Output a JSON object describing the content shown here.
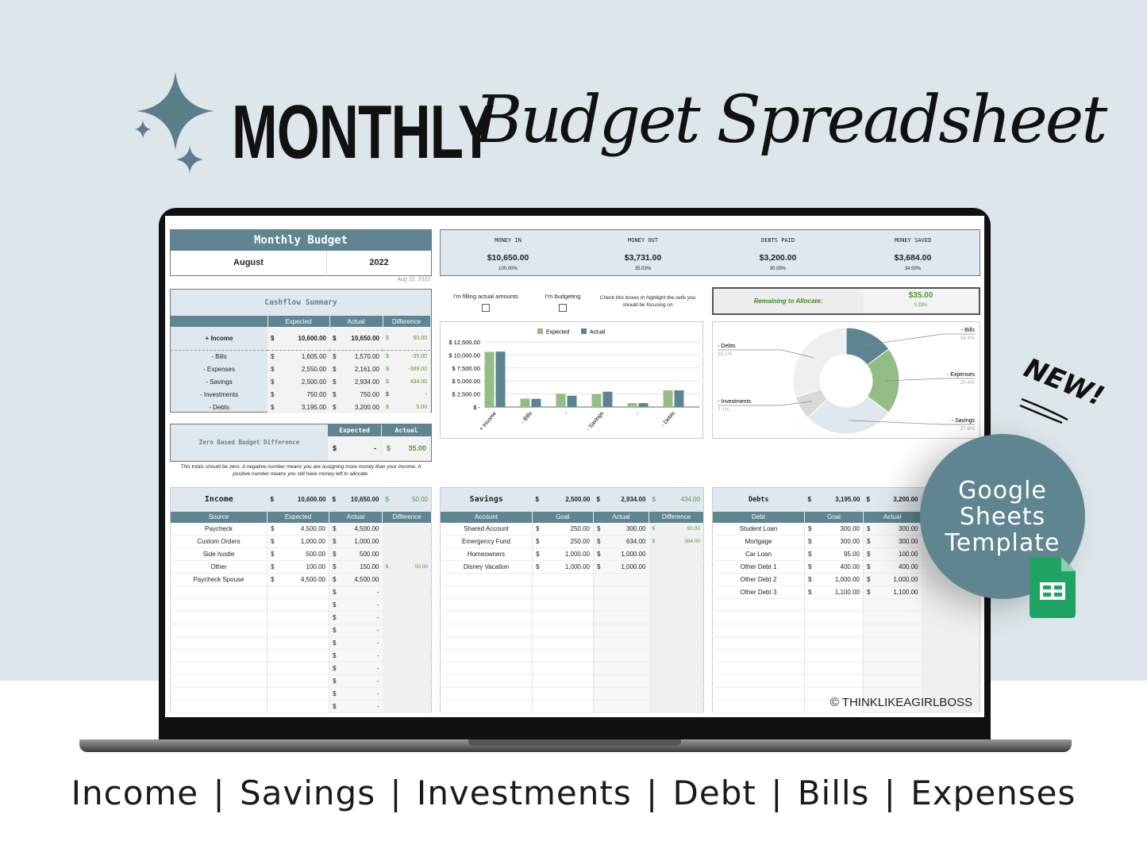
{
  "headline": {
    "bold": "MONTHLY",
    "script": "Budget Spreadsheet"
  },
  "footer_categories": "Income  |  Savings  |  Investments  |  Debt  |  Bills  |  Expenses",
  "badge": {
    "text_lines": [
      "Google",
      "Sheets",
      "Template"
    ],
    "new_label": "NEW!",
    "copyright": "© THINKLIKEAGIRLBOSS"
  },
  "colors": {
    "header": "#5f8591",
    "light": "#dfe8ee",
    "positive": "#4f9a2c",
    "expected_bar": "#93bd86",
    "actual_bar": "#5d8491",
    "sheets_green": "#1fa463"
  },
  "sheet": {
    "title": "Monthly Budget",
    "month": "August",
    "year": "2022",
    "date": "Aug 31, 2022",
    "kpis": [
      {
        "label": "MONEY IN",
        "value": "$10,650.00",
        "pct": "100.00%"
      },
      {
        "label": "MONEY OUT",
        "value": "$3,731.00",
        "pct": "35.03%"
      },
      {
        "label": "DEBTS PAID",
        "value": "$3,200.00",
        "pct": "30.05%"
      },
      {
        "label": "MONEY SAVED",
        "value": "$3,684.00",
        "pct": "34.59%"
      }
    ],
    "checkboxes": {
      "actual_label": "I'm filling actual amounts",
      "budget_label": "I'm budgeting",
      "actual_checked": false,
      "budget_checked": false,
      "hint": "Check this boxes to highlight the cells you should be focusing on"
    },
    "remaining": {
      "label": "Remaining to Allocate:",
      "value": "$35.00",
      "pct": "0.33%"
    },
    "cashflow": {
      "title": "Cashflow Summary",
      "columns": [
        "",
        "Expected",
        "Actual",
        "Difference"
      ],
      "rows": [
        {
          "name": "+ Income",
          "expected": "10,600.00",
          "actual": "10,650.00",
          "diff": "50.00"
        },
        {
          "name": "- Bills",
          "expected": "1,605.00",
          "actual": "1,570.00",
          "diff": "-35.00"
        },
        {
          "name": "- Expenses",
          "expected": "2,550.00",
          "actual": "2,161.00",
          "diff": "-389.00"
        },
        {
          "name": "- Savings",
          "expected": "2,500.00",
          "actual": "2,934.00",
          "diff": "434.00"
        },
        {
          "name": "- Investments",
          "expected": "750.00",
          "actual": "750.00",
          "diff": "-"
        },
        {
          "name": "- Debts",
          "expected": "3,195.00",
          "actual": "3,200.00",
          "diff": "5.00"
        }
      ]
    },
    "zero_based": {
      "title": "Zero Based Budget Difference",
      "expected_label": "Expected",
      "actual_label": "Actual",
      "expected": "-",
      "actual": "35.00",
      "note": "This totals should be zero. A negative number means you are assigning more money than your income. A positive number means you still have money left to allocate."
    },
    "income": {
      "title": "Income",
      "expected_total": "10,600.00",
      "actual_total": "10,650.00",
      "diff_total": "50.00",
      "columns": [
        "Source",
        "Expected",
        "Actual",
        "Difference"
      ],
      "rows": [
        {
          "name": "Paycheck",
          "expected": "4,500.00",
          "actual": "4,500.00"
        },
        {
          "name": "Custom Orders",
          "expected": "1,000.00",
          "actual": "1,000.00"
        },
        {
          "name": "Side hustle",
          "expected": "500.00",
          "actual": "500.00"
        },
        {
          "name": "Other",
          "expected": "100.00",
          "actual": "150.00",
          "diff": "50.00"
        },
        {
          "name": "Paycheck Spouse",
          "expected": "4,500.00",
          "actual": "4,500.00"
        },
        {
          "actual": "-"
        },
        {
          "actual": "-"
        },
        {
          "actual": "-"
        },
        {
          "actual": "-"
        },
        {
          "actual": "-"
        },
        {
          "actual": "-"
        },
        {
          "actual": "-"
        },
        {
          "actual": "-"
        },
        {
          "actual": "-"
        },
        {
          "actual": "-"
        }
      ]
    },
    "savings": {
      "title": "Savings",
      "expected_total": "2,500.00",
      "actual_total": "2,934.00",
      "diff_total": "434.00",
      "columns": [
        "Account",
        "Goal",
        "Actual",
        "Difference"
      ],
      "rows": [
        {
          "name": "Shared Account",
          "expected": "250.00",
          "actual": "300.00",
          "diff": "50.00"
        },
        {
          "name": "Emergency Fund",
          "expected": "250.00",
          "actual": "634.00",
          "diff": "384.00"
        },
        {
          "name": "Homeowners",
          "expected": "1,000.00",
          "actual": "1,000.00"
        },
        {
          "name": "Disney Vacation",
          "expected": "1,000.00",
          "actual": "1,000.00"
        },
        {},
        {},
        {},
        {},
        {},
        {},
        {},
        {},
        {},
        {},
        {}
      ]
    },
    "debts": {
      "title": "Debts",
      "expected_total": "3,195.00",
      "actual_total": "3,200.00",
      "columns": [
        "Debt",
        "Goal",
        "Actual",
        ""
      ],
      "rows": [
        {
          "name": "Student Loan",
          "expected": "300.00",
          "actual": "300.00"
        },
        {
          "name": "Mortgage",
          "expected": "300.00",
          "actual": "300.00"
        },
        {
          "name": "Car Loan",
          "expected": "95.00",
          "actual": "100.00"
        },
        {
          "name": "Other Debt 1",
          "expected": "400.00",
          "actual": "400.00"
        },
        {
          "name": "Other Debt 2",
          "expected": "1,000.00",
          "actual": "1,000.00"
        },
        {
          "name": "Other Debt 3",
          "expected": "1,100.00",
          "actual": "1,100.00"
        },
        {},
        {},
        {},
        {},
        {},
        {},
        {},
        {},
        {}
      ]
    }
  },
  "chart_data": [
    {
      "type": "bar",
      "categories": [
        "+ Income",
        "- Bills",
        "-",
        "- Savings",
        "-",
        "- Debts"
      ],
      "series": [
        {
          "name": "Expected",
          "values": [
            10600,
            1605,
            2550,
            2500,
            750,
            3195
          ]
        },
        {
          "name": "Actual",
          "values": [
            10650,
            1570,
            2161,
            2934,
            750,
            3200
          ]
        }
      ],
      "yticks": [
        "$ -",
        "$ 2,500.00",
        "$ 5,000.00",
        "$ 7,500.00",
        "$ 10,000.00",
        "$ 12,500.00"
      ],
      "ylim": [
        0,
        12500
      ],
      "grid": true,
      "legend": "top"
    },
    {
      "type": "pie",
      "donut": true,
      "labels": [
        "- Bills",
        "- Expenses",
        "- Savings",
        "- Investments",
        "- Debts"
      ],
      "values": [
        14.8,
        20.4,
        27.6,
        7.1,
        30.1
      ],
      "pct_labels": [
        "14.8%",
        "20.4%",
        "27.6%",
        "7.1%",
        "30.1%"
      ],
      "colors": [
        "#5d8491",
        "#93bd86",
        "#dfe8ee",
        "#d9d9d9",
        "#efefef"
      ]
    }
  ]
}
